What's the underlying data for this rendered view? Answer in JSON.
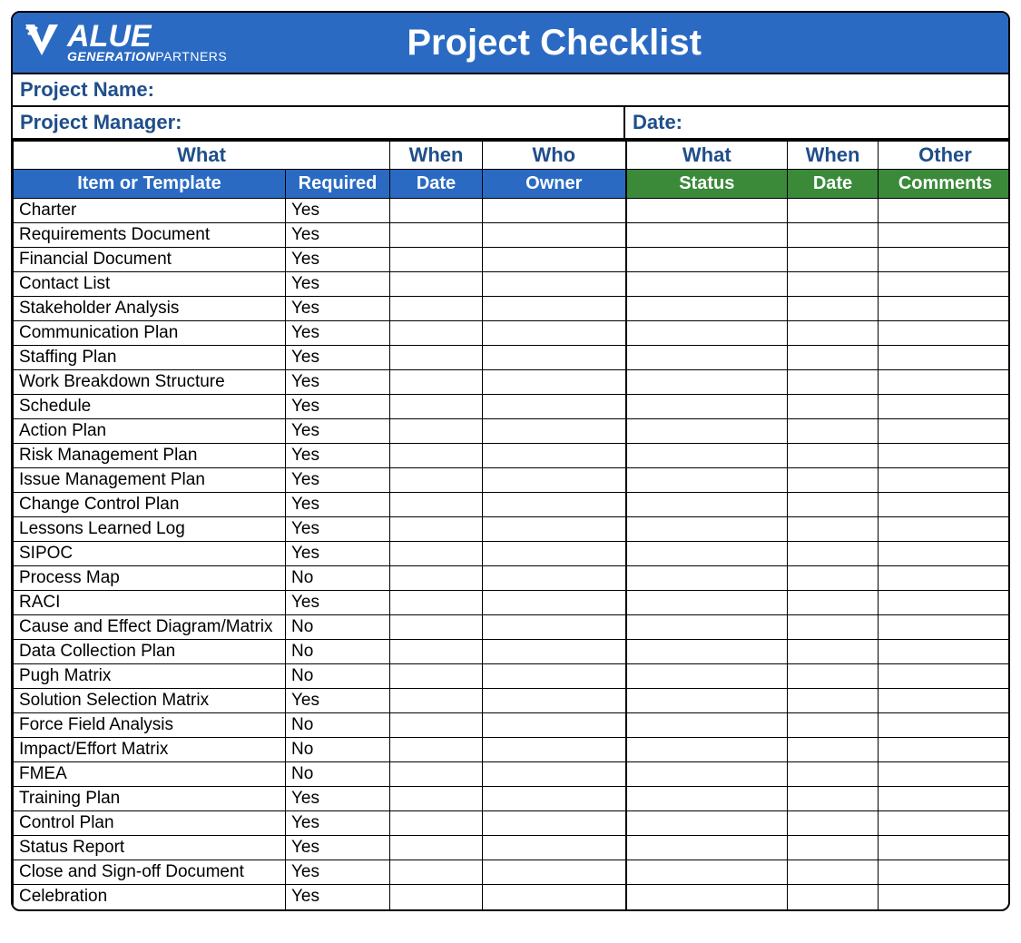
{
  "header": {
    "logo_main": "ALUE",
    "logo_sub_1": "GENERATION",
    "logo_sub_2": "PARTNERS",
    "title": "Project Checklist"
  },
  "info": {
    "project_name_label": "Project Name:",
    "project_manager_label": "Project Manager:",
    "date_label": "Date:"
  },
  "group_headers": {
    "left_what": "What",
    "when_1": "When",
    "who": "Who",
    "right_what": "What",
    "when_2": "When",
    "other": "Other"
  },
  "col_headers": {
    "item": "Item or Template",
    "required": "Required",
    "date1": "Date",
    "owner": "Owner",
    "status": "Status",
    "date2": "Date",
    "comments": "Comments"
  },
  "rows": [
    {
      "item": "Charter",
      "required": "Yes"
    },
    {
      "item": "Requirements Document",
      "required": "Yes"
    },
    {
      "item": "Financial Document",
      "required": "Yes"
    },
    {
      "item": "Contact List",
      "required": "Yes"
    },
    {
      "item": "Stakeholder Analysis",
      "required": "Yes"
    },
    {
      "item": "Communication Plan",
      "required": "Yes"
    },
    {
      "item": "Staffing Plan",
      "required": "Yes"
    },
    {
      "item": "Work Breakdown Structure",
      "required": "Yes"
    },
    {
      "item": "Schedule",
      "required": "Yes"
    },
    {
      "item": "Action Plan",
      "required": "Yes"
    },
    {
      "item": "Risk Management Plan",
      "required": "Yes"
    },
    {
      "item": "Issue Management Plan",
      "required": "Yes"
    },
    {
      "item": "Change Control Plan",
      "required": "Yes"
    },
    {
      "item": "Lessons Learned Log",
      "required": "Yes"
    },
    {
      "item": "SIPOC",
      "required": "Yes"
    },
    {
      "item": "Process Map",
      "required": "No"
    },
    {
      "item": "RACI",
      "required": "Yes"
    },
    {
      "item": "Cause and Effect Diagram/Matrix",
      "required": "No"
    },
    {
      "item": "Data Collection Plan",
      "required": "No"
    },
    {
      "item": "Pugh Matrix",
      "required": "No"
    },
    {
      "item": "Solution Selection Matrix",
      "required": "Yes"
    },
    {
      "item": "Force Field Analysis",
      "required": "No"
    },
    {
      "item": "Impact/Effort Matrix",
      "required": "No"
    },
    {
      "item": "FMEA",
      "required": "No"
    },
    {
      "item": "Training Plan",
      "required": "Yes"
    },
    {
      "item": "Control Plan",
      "required": "Yes"
    },
    {
      "item": "Status Report",
      "required": "Yes"
    },
    {
      "item": "Close and Sign-off Document",
      "required": "Yes"
    },
    {
      "item": "Celebration",
      "required": "Yes"
    }
  ]
}
